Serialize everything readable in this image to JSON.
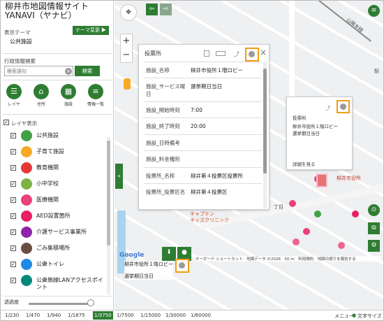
{
  "sidebar": {
    "title_line1": "柳井市地図情報サイト",
    "title_line2": "YANAVI（ヤナビ）",
    "theme_label": "表示テーマ",
    "theme_change_button": "テーマ変更 ▶",
    "theme_value": "公共施設",
    "admin_label": "行政情報検索",
    "search_placeholder": "検索語句",
    "search_button": "検索",
    "tools": [
      {
        "label": "レイヤ",
        "icon": "layers-icon"
      },
      {
        "label": "住所",
        "icon": "home-icon"
      },
      {
        "label": "施設",
        "icon": "building-icon"
      },
      {
        "label": "情報一覧",
        "icon": "list-icon"
      }
    ],
    "layer_display_label": "レイヤ表示",
    "layers": [
      {
        "label": "公共施設",
        "color": "#43a047"
      },
      {
        "label": "子育て施設",
        "color": "#f9a825"
      },
      {
        "label": "教育機関",
        "color": "#e53935"
      },
      {
        "label": "小中学校",
        "color": "#7cb342"
      },
      {
        "label": "医療機関",
        "color": "#ec407a"
      },
      {
        "label": "AED設置箇所",
        "color": "#e91e63"
      },
      {
        "label": "介護サービス事業所",
        "color": "#8e24aa"
      },
      {
        "label": "ごみ集積場所",
        "color": "#6d4c41"
      },
      {
        "label": "公衆トイレ",
        "color": "#1e88e5"
      },
      {
        "label": "公衆無線LANアクセスポイント",
        "color": "#00897b"
      }
    ],
    "opacity_label": "透過度",
    "opacity_value": 0.95
  },
  "scale_bar": {
    "items": [
      "1/230",
      "1/470",
      "1/940",
      "1/1875",
      "1/3750",
      "1/7500",
      "1/15000",
      "1/30000",
      "1/60000"
    ],
    "active": "1/3750",
    "right_menu": "メニュー",
    "right_text": "文字サイズ"
  },
  "popup": {
    "title": "投票所",
    "rows": [
      {
        "key": "施設_名称",
        "value": "柳井市役所１階ロビー"
      },
      {
        "key": "施設_サービス曜日",
        "value": "選挙期日当日"
      },
      {
        "key": "施設_開始時刻",
        "value": "7:00"
      },
      {
        "key": "施設_終了時刻",
        "value": "20:00"
      },
      {
        "key": "施設_日時備考",
        "value": ""
      },
      {
        "key": "施設_料金種別",
        "value": ""
      },
      {
        "key": "投票所_名称",
        "value": "柳井第４投票区投票所"
      },
      {
        "key": "投票所_投票区名",
        "value": "柳井第４投票区"
      }
    ]
  },
  "popup_small": {
    "line1": "投票所",
    "line2": "柳井市役所１階ロビー",
    "line3": "選挙期日当日",
    "link": "詳細を見る"
  },
  "tooltip": {
    "line1": "柳井市役所１階ロビー",
    "line2": "選挙期日当日"
  },
  "map": {
    "labels": {
      "city_hall": "柳井市役所",
      "rail": "山陽本線",
      "station": "駅",
      "clinic1": "キャプテン",
      "clinic2": "キッズクリニック",
      "chome": "丁目",
      "google": "Google",
      "attrib": "キーボード ショートカット　地図データ ©2026　50 m　利用規約　地図の誤りを報告する"
    }
  }
}
